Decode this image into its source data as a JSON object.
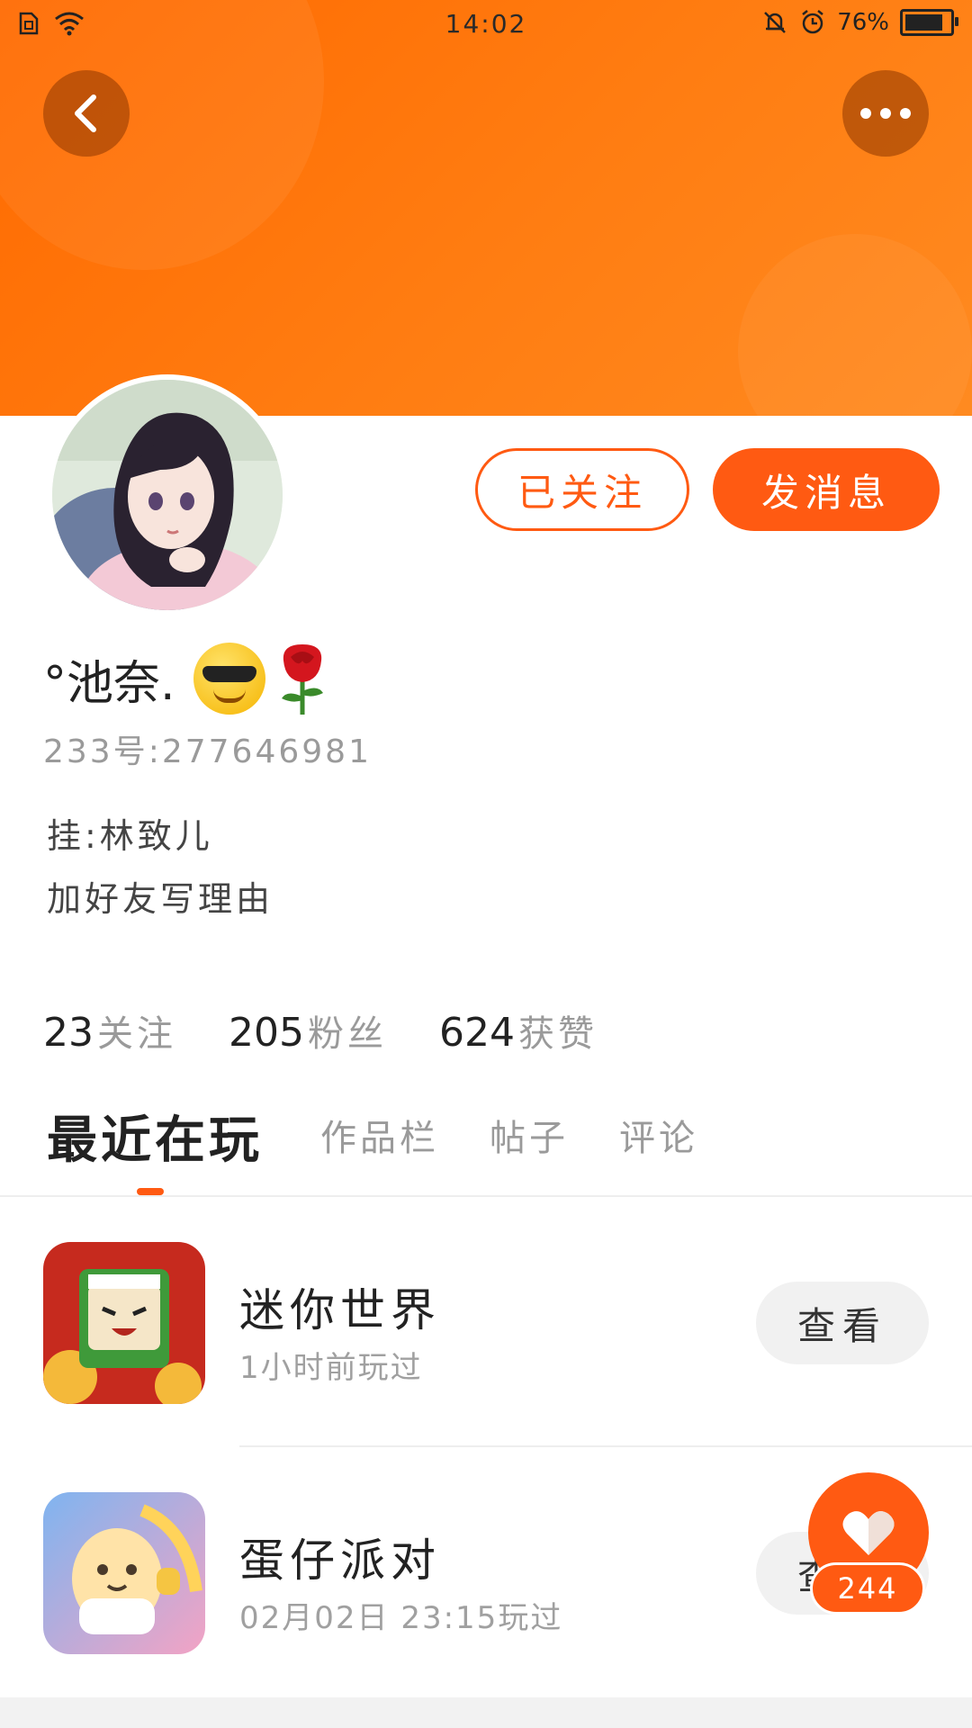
{
  "status_bar": {
    "time": "14:02",
    "battery": "76%",
    "icons": [
      "sim-icon",
      "wifi-icon",
      "mute-bell-icon",
      "alarm-icon",
      "battery-icon"
    ]
  },
  "header": {
    "back_icon": "chevron-left-icon",
    "more_icon": "more-dots-icon",
    "accent_color": "#ff6a00"
  },
  "profile": {
    "followed_label": "已关注",
    "message_label": "发消息",
    "nickname": "°池奈.",
    "emojis": [
      "sunglasses-emoji",
      "rose-emoji"
    ],
    "uid": "233号:277646981",
    "bio_line1": "挂:林致儿",
    "bio_line2": "加好友写理由"
  },
  "stats": [
    {
      "num": "23",
      "label": "关注"
    },
    {
      "num": "205",
      "label": "粉丝"
    },
    {
      "num": "624",
      "label": "获赞"
    }
  ],
  "tabs": [
    {
      "label": "最近在玩",
      "active": true
    },
    {
      "label": "作品栏",
      "active": false
    },
    {
      "label": "帖子",
      "active": false
    },
    {
      "label": "评论",
      "active": false
    }
  ],
  "games": [
    {
      "name": "迷你世界",
      "sub": "1小时前玩过",
      "button": "查看"
    },
    {
      "name": "蛋仔派对",
      "sub": "02月02日 23:15玩过",
      "button": "查看"
    }
  ],
  "like": {
    "count": "244"
  }
}
